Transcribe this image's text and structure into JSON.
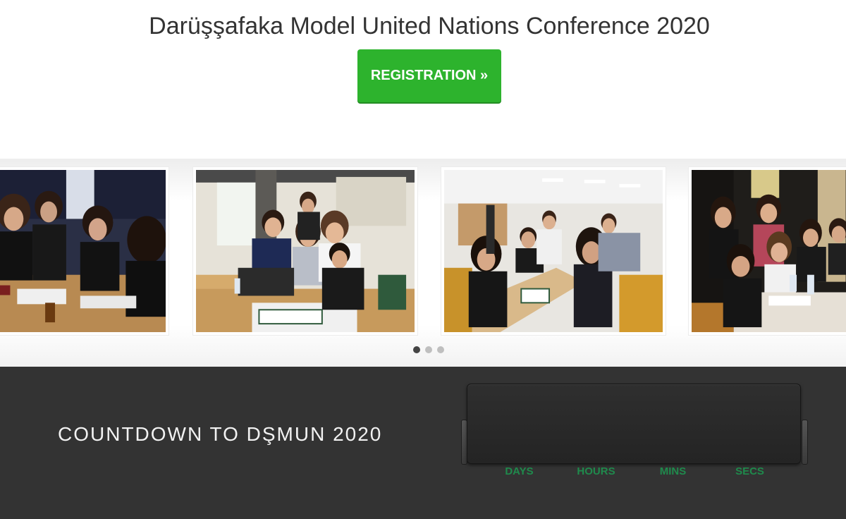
{
  "hero": {
    "title": "Darüşşafaka Model United Nations Conference 2020",
    "registration_label": "REGISTRATION »",
    "registration_color": "#2db32d"
  },
  "carousel": {
    "slides": [
      {
        "name": "Delegates working at committee tables"
      },
      {
        "name": "Delegates discussing around laptop"
      },
      {
        "name": "Committee room with placards"
      },
      {
        "name": "Delegates in crowded session"
      }
    ],
    "active_dot": 1,
    "dot_count": 3
  },
  "countdown": {
    "title": "COUNTDOWN TO DŞMUN 2020",
    "labels": [
      "DAYS",
      "HOURS",
      "MINS",
      "SECS"
    ],
    "label_color": "#1f8a4c",
    "background": "#333333"
  }
}
